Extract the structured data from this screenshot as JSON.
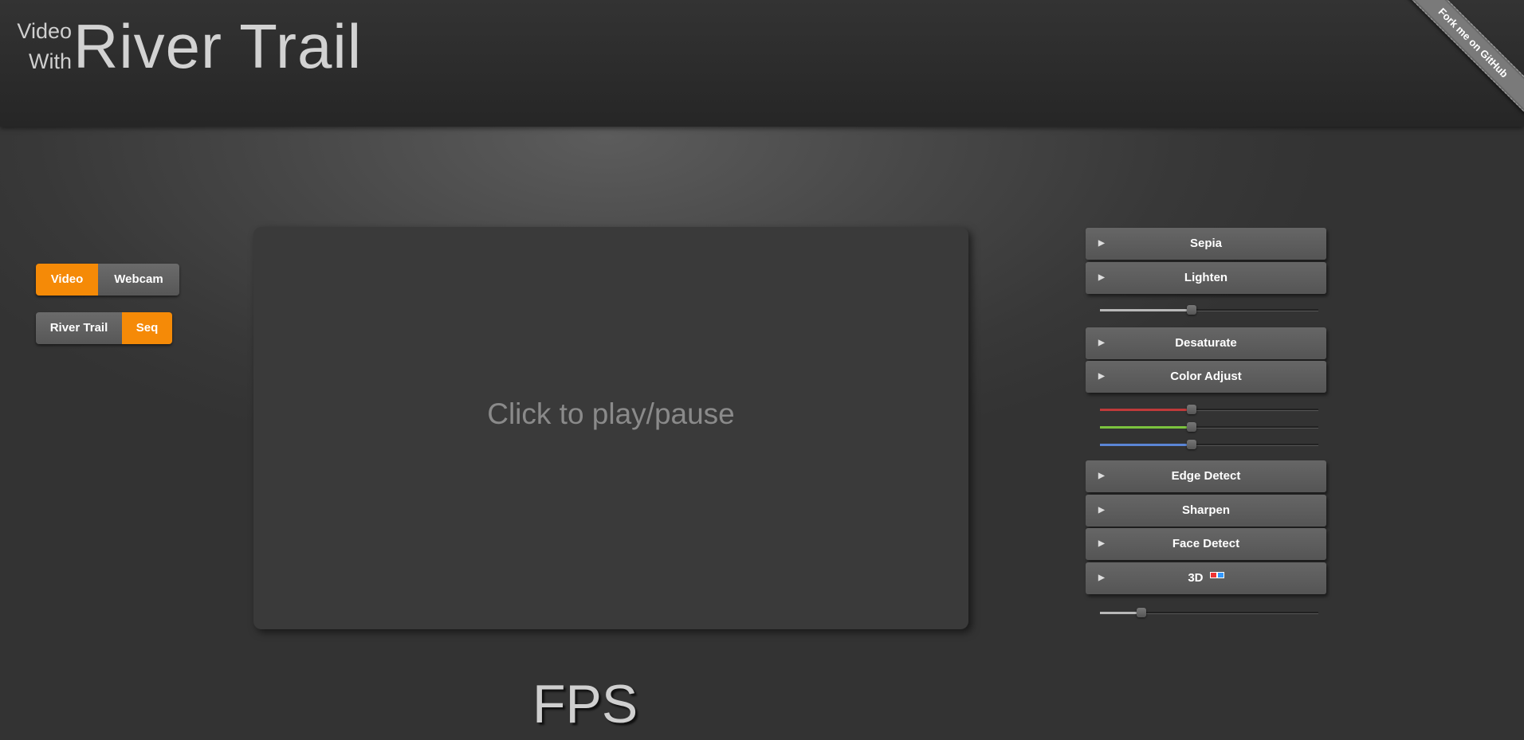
{
  "header": {
    "logo_line1": "Video",
    "logo_line2": "With",
    "logo_title": "River Trail",
    "ribbon": "Fork me on GitHub"
  },
  "source_toggle": {
    "options": [
      "Video",
      "Webcam"
    ],
    "selected": "Video"
  },
  "mode_toggle": {
    "options": [
      "River Trail",
      "Seq"
    ],
    "selected": "Seq"
  },
  "video": {
    "message": "Click to play/pause"
  },
  "fps_label": "FPS",
  "filters": {
    "sepia": "Sepia",
    "lighten": "Lighten",
    "desaturate": "Desaturate",
    "color_adjust": "Color Adjust",
    "edge_detect": "Edge Detect",
    "sharpen": "Sharpen",
    "face_detect": "Face Detect",
    "three_d": "3D"
  },
  "sliders": {
    "lighten": 0.42,
    "red": 0.42,
    "green": 0.42,
    "blue": 0.42,
    "three_d": 0.19
  },
  "colors": {
    "accent": "#f58a07",
    "red": "#c03a3a",
    "green": "#7cc33e",
    "blue": "#5b86d6",
    "neutral_fill": "#b8b8b8"
  }
}
